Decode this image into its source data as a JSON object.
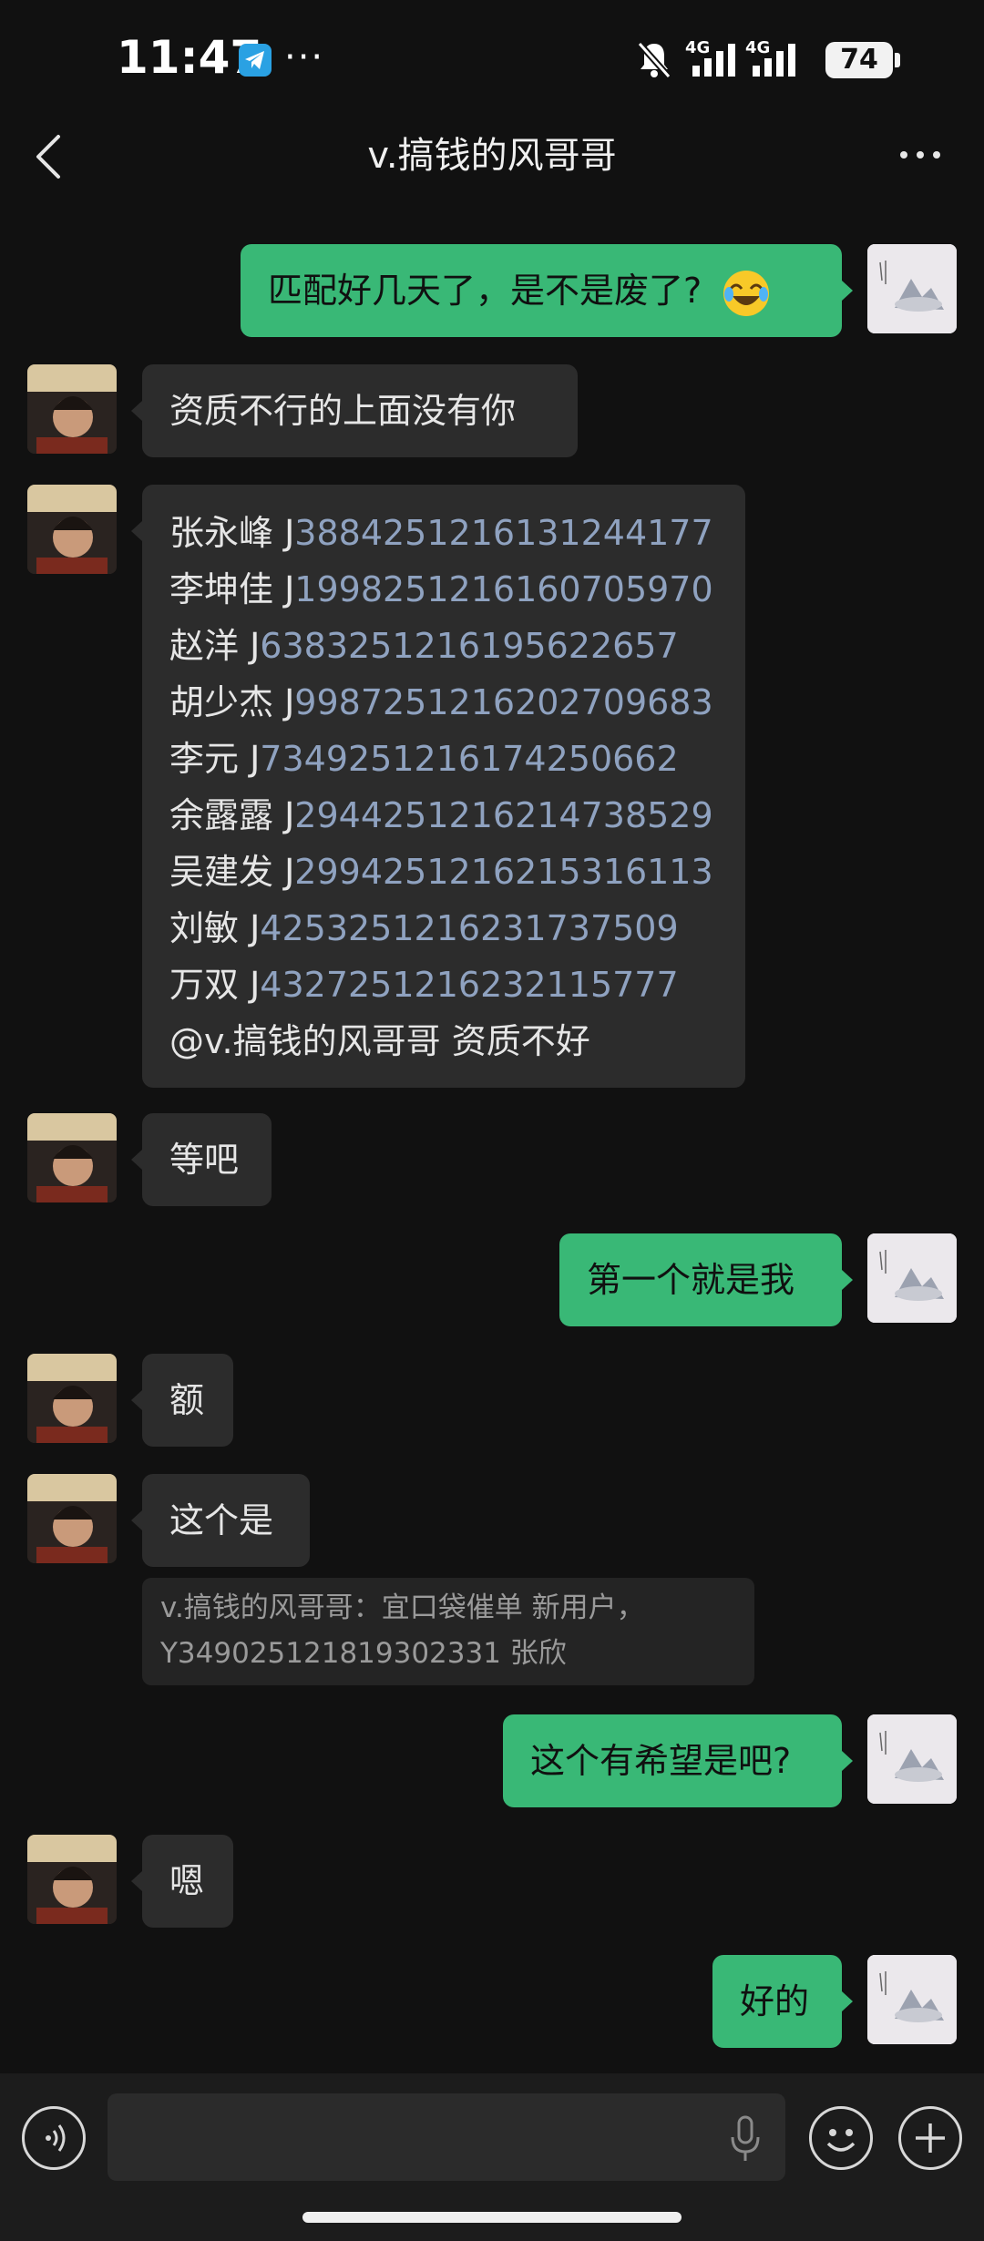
{
  "status_bar": {
    "time": "11:47",
    "dots": "···",
    "net1": "4G",
    "net2": "4G",
    "battery": "74",
    "icons": [
      "telegram-icon",
      "mute-icon",
      "signal-icon",
      "battery-icon"
    ]
  },
  "header": {
    "title": "v.搞钱的风哥哥",
    "back_icon": "chevron-left-icon",
    "more_icon": "more-icon"
  },
  "messages": [
    {
      "from": "me",
      "text": "匹配好几天了，是不是废了?",
      "emoji": "joy-emoji"
    },
    {
      "from": "peer",
      "text": "资质不行的上面没有你"
    },
    {
      "from": "peer",
      "list": [
        {
          "name": "张永峰 J",
          "num": "388425121613124417"
        },
        {
          "name": "李坤佳 J",
          "num": "199825121616070597"
        },
        {
          "name": "赵洋 J",
          "num": "638325121619562265"
        },
        {
          "name": "胡少杰 J",
          "num": "998725121620270968"
        },
        {
          "name": "李元 J",
          "num": "734925121617425066"
        },
        {
          "name": "余露露 J",
          "num": "294425121621473852"
        },
        {
          "name": "吴建发 J",
          "num": "299425121621531611"
        },
        {
          "name": "刘敏 J",
          "num": "425325121623173750"
        },
        {
          "name": "万双 J",
          "num": "432725121623211577"
        }
      ],
      "footer": "@v.搞钱的风哥哥  资质不好"
    },
    {
      "from": "peer",
      "text": "等吧"
    },
    {
      "from": "me",
      "text": "第一个就是我"
    },
    {
      "from": "peer",
      "text": "额"
    },
    {
      "from": "peer",
      "text": "这个是",
      "quote": [
        "v.搞钱的风哥哥：宜口袋催单 新用户，",
        "Y349025121819302331 张欣"
      ]
    },
    {
      "from": "me",
      "text": "这个有希望是吧?"
    },
    {
      "from": "peer",
      "text": "嗯"
    },
    {
      "from": "me",
      "text": "好的"
    }
  ],
  "list_suffixes": [
    "7",
    "0",
    "7",
    "3",
    "2",
    "9",
    "3",
    "9",
    "7"
  ],
  "input": {
    "placeholder": "",
    "voice_icon": "voice-icon",
    "mic_icon": "mic-icon",
    "emoji_icon": "emoji-icon",
    "plus_icon": "plus-icon"
  },
  "colors": {
    "background": "#111111",
    "out_bubble": "#39b876",
    "in_bubble": "#2c2c2c",
    "link_number": "#8fa2c0"
  }
}
